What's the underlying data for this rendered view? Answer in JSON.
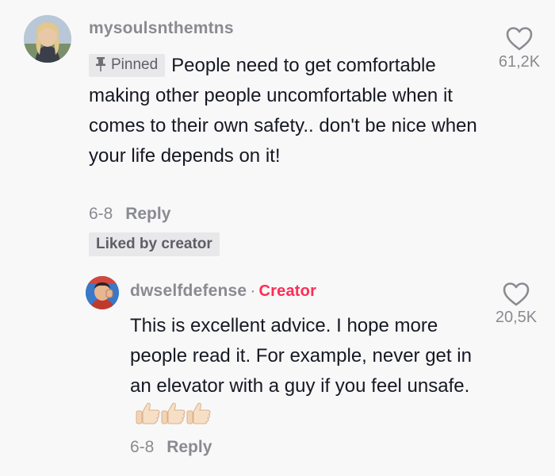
{
  "comment": {
    "username": "mysoulsnthemtns",
    "pinned_label": "Pinned",
    "text": "People need to get comfortable making other people uncomfortable when it comes to their own safety.. don't be nice when your life depends on it!",
    "date": "6-8",
    "reply_label": "Reply",
    "liked_by_label": "Liked by creator",
    "like_count": "61,2K"
  },
  "reply": {
    "username": "dwselfdefense",
    "separator": "·",
    "creator_label": "Creator",
    "text": "This is excellent advice. I hope more people read it. For example, never get in an elevator with a guy if you feel unsafe.",
    "date": "6-8",
    "reply_label": "Reply",
    "like_count": "20,5K"
  },
  "icons": {
    "pin": "pin-icon",
    "heart": "heart-outline-icon",
    "thumbs_up": "thumbs-up-emoji"
  },
  "colors": {
    "creator_accent": "#fe2c55",
    "muted_text": "#8a8b91",
    "badge_bg": "#e8e8ea"
  }
}
